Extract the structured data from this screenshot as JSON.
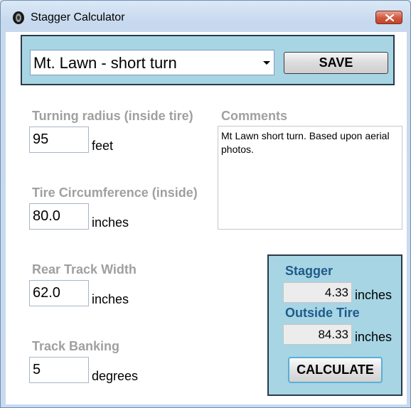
{
  "window": {
    "title": "Stagger Calculator"
  },
  "profile": {
    "selected": "Mt. Lawn - short turn",
    "save_label": "SAVE"
  },
  "fields": {
    "turning_radius": {
      "label": "Turning radius (inside tire)",
      "value": "95",
      "unit": "feet"
    },
    "tire_circumference": {
      "label": "Tire Circumference (inside)",
      "value": "80.0",
      "unit": "inches"
    },
    "rear_track_width": {
      "label": "Rear Track Width",
      "value": "62.0",
      "unit": "inches"
    },
    "track_banking": {
      "label": "Track Banking",
      "value": "5",
      "unit": "degrees"
    }
  },
  "comments": {
    "label": "Comments",
    "text": "Mt Lawn short turn.  Based upon aerial photos."
  },
  "results": {
    "stagger": {
      "label": "Stagger",
      "value": "4.33",
      "unit": "inches"
    },
    "outside_tire": {
      "label": "Outside Tire",
      "value": "84.33",
      "unit": "inches"
    },
    "calculate_label": "CALCULATE"
  },
  "icons": {
    "app": "app-icon",
    "close": "close-icon",
    "dropdown": "chevron-down-icon"
  },
  "colors": {
    "panel": "#a7d5e4",
    "result_label": "#1f5b8a",
    "disabled_label": "#a0a0a0",
    "close_button": "#d0573f"
  }
}
